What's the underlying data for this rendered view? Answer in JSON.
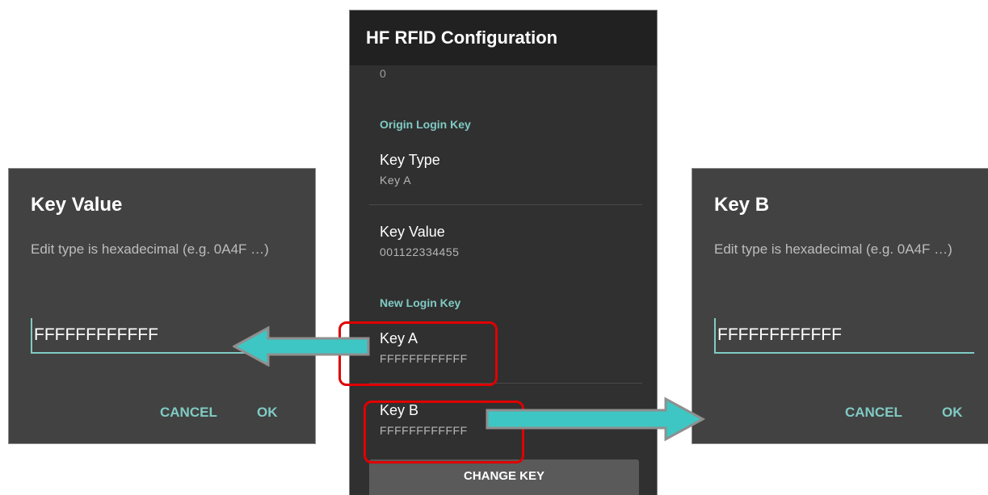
{
  "app": {
    "title": "HF RFID Configuration",
    "scrolled_value": "0",
    "sections": {
      "origin": "Origin Login Key",
      "new": "New Login Key"
    },
    "prefs": {
      "key_type": {
        "title": "Key Type",
        "summary": "Key A"
      },
      "key_value": {
        "title": "Key Value",
        "summary": "001122334455"
      },
      "key_a": {
        "title": "Key A",
        "summary": "FFFFFFFFFFFF"
      },
      "key_b": {
        "title": "Key B",
        "summary": "FFFFFFFFFFFF"
      }
    },
    "change_key_label": "CHANGE KEY"
  },
  "dialog_left": {
    "title": "Key Value",
    "message": "Edit type is hexadecimal (e.g. 0A4F …)",
    "value": "FFFFFFFFFFFF",
    "cancel_label": "CANCEL",
    "ok_label": "OK"
  },
  "dialog_right": {
    "title": "Key B",
    "message": "Edit type is hexadecimal (e.g. 0A4F …)",
    "value": "FFFFFFFFFFFF",
    "cancel_label": "CANCEL",
    "ok_label": "OK"
  },
  "colors": {
    "accent": "#80cbc4",
    "highlight": "#e00000",
    "arrow_fill": "#3ec6c4",
    "arrow_outline": "#8f8f8f",
    "appbar": "#212121",
    "screen": "#303030",
    "dialog": "#424242"
  }
}
